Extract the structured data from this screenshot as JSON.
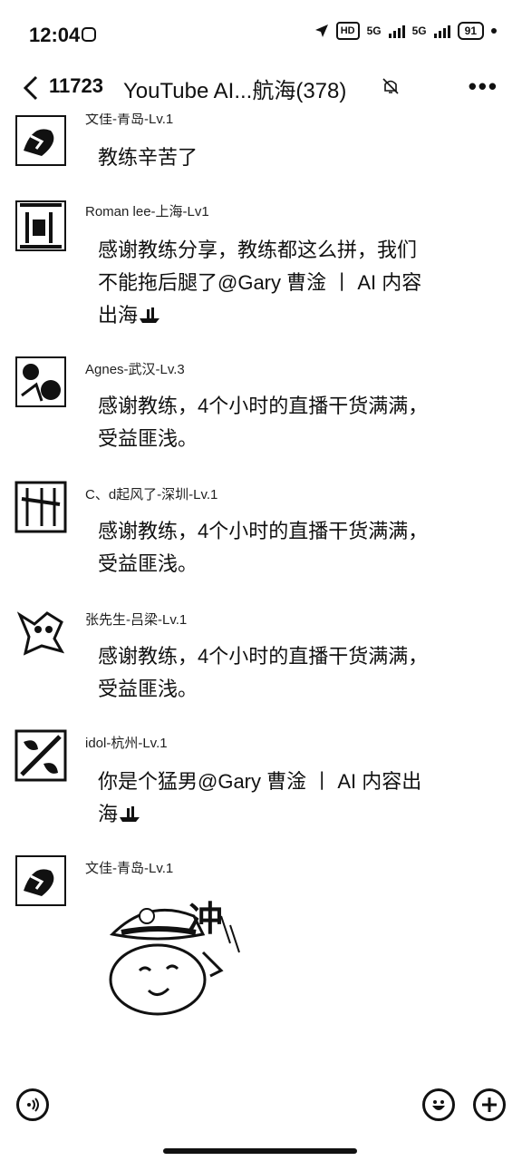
{
  "status_bar": {
    "time": "12:04",
    "hd": "HD",
    "net1": "5G",
    "net2": "5G",
    "battery": "91"
  },
  "header": {
    "unread_count": "11723",
    "title": "YouTube AI...航海(378)"
  },
  "messages": [
    {
      "sender": "文佳-青岛-Lv.1",
      "text": "教练辛苦了"
    },
    {
      "sender": "Roman lee-上海-Lv1",
      "text": "感谢教练分享，教练都这么拼，我们不能拖后腿了@Gary 曹淦 丨 AI 内容出海"
    },
    {
      "sender": "Agnes-武汉-Lv.3",
      "text": "感谢教练，4个小时的直播干货满满，受益匪浅。"
    },
    {
      "sender": "C、d起风了-深圳-Lv.1",
      "text": "感谢教练，4个小时的直播干货满满，受益匪浅。"
    },
    {
      "sender": "张先生-吕梁-Lv.1",
      "text": "感谢教练，4个小时的直播干货满满，受益匪浅。"
    },
    {
      "sender": "idol-杭州-Lv.1",
      "text": "你是个猛男@Gary 曹淦 丨 AI 内容出海"
    },
    {
      "sender": "文佳-青岛-Lv.1",
      "text": ""
    }
  ],
  "sticker": {
    "text": "冲"
  }
}
